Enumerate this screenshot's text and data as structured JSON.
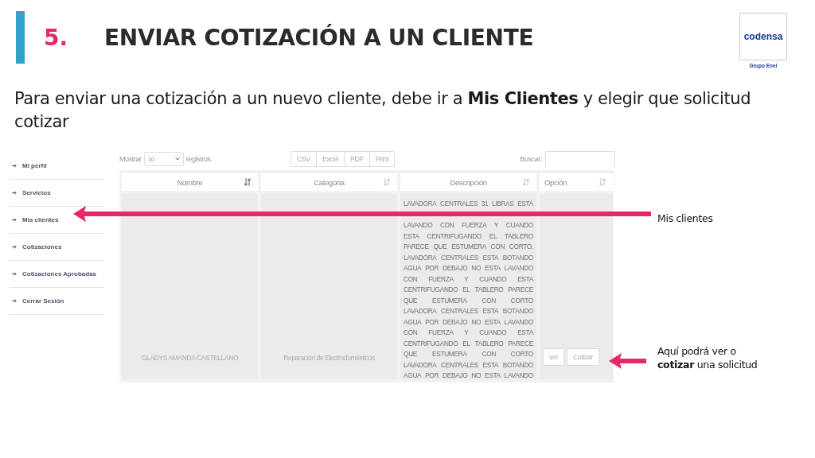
{
  "title": {
    "number": "5.",
    "text": "ENVIAR COTIZACIÓN A UN CLIENTE"
  },
  "logo": {
    "name": "codensa",
    "caption": "Grupo Enel"
  },
  "intro": "Para enviar una cotización a un nuevo cliente, debe ir a **Mis Clientes** y elegir que solicitud cotizar",
  "sidebar": {
    "items": [
      {
        "label": "Mi perfil",
        "selected": false
      },
      {
        "label": "Servicios",
        "selected": false
      },
      {
        "label": "Mis clientes",
        "selected": false
      },
      {
        "label": "Cotizaciones",
        "selected": false
      },
      {
        "label": "Cotizaciones Aprobadas",
        "selected": false
      },
      {
        "label": "Cerrar Sesión",
        "selected": false
      }
    ]
  },
  "toolbar": {
    "show_label": "Mostrar",
    "page_size": "10",
    "records_label": "registros",
    "export_buttons": [
      "CSV",
      "Excel",
      "PDF",
      "Print"
    ],
    "search_label": "Buscar:"
  },
  "table": {
    "columns": [
      {
        "label": "Nombre",
        "sorted": true
      },
      {
        "label": "Categoria",
        "sorted": false
      },
      {
        "label": "Descripción",
        "sorted": false
      },
      {
        "label": "Opción",
        "sorted": false
      }
    ],
    "rows": [
      {
        "nombre": "GLADYS AMANDA CASTELLANO",
        "categoria": "Reparación de Electrodomésticos",
        "description_lines": [
          "LAVADORA CENTRALES 31 LIBRAS ESTA",
          "LAVANDO CON FUERZA Y CUANDO",
          "ESTA CENTRIFUGANDO EL TABLERO",
          "PARECE QUE ESTUMERA CON CORTO.",
          "LAVADORA CENTRALES ESTA BOTANDO",
          "AGUA POR DEBAJO NO ESTA LAVANDO",
          "CON FUERZA Y CUANDO ESTA",
          "CENTRIFUGANDO EL TABLERO PARECE",
          "QUE ESTUMERA CON CORTO",
          "LAVADORA CENTRALES ESTA BOTANDO",
          "AGUA POR DEBAJO NO ESTA LAVANDO",
          "CON FUERZA Y CUANDO ESTA",
          "CENTRIFUGANDO EL TABLERO PARECE",
          "QUE ESTUMERA CON CORTO",
          "LAVADORA CENTRALES ESTA BOTANDO",
          "AGUA POR DEBAJO NO ESTA LAVANDO"
        ],
        "actions": [
          "ver",
          "Cotizar"
        ]
      }
    ]
  },
  "callouts": [
    {
      "text": "Mis clientes"
    },
    {
      "text": "Aquí podrá ver o **cotizar** una solicitud"
    }
  ]
}
